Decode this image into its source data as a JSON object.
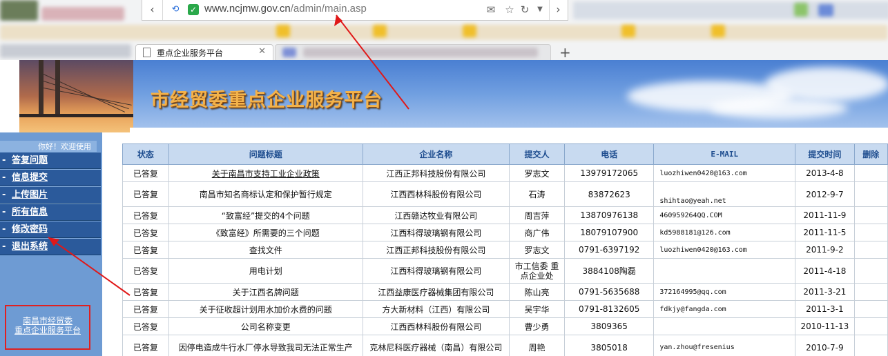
{
  "browser": {
    "url_host": "www.ncjmw.gov.cn",
    "url_path": "/admin/main.asp",
    "active_tab_title": "重点企业服务平台"
  },
  "banner": {
    "title": "市经贸委重点企业服务平台"
  },
  "sidebar": {
    "greeting": "你好！欢迎使用",
    "items": [
      {
        "label": "答复问题"
      },
      {
        "label": "信息提交"
      },
      {
        "label": "上传图片"
      },
      {
        "label": "所有信息"
      },
      {
        "label": "修改密码"
      },
      {
        "label": "退出系统"
      }
    ],
    "footer_line1": "南昌市经贸委",
    "footer_line2": "重点企业服务平台"
  },
  "table": {
    "headers": [
      "状态",
      "问题标题",
      "企业名称",
      "提交人",
      "电话",
      "E-MAIL",
      "提交时间",
      "删除"
    ],
    "rows": [
      {
        "status": "已答复",
        "title": "关于南昌市支持工业企业政策",
        "company": "江西正邦科技股份有限公司",
        "submitter": "罗志文",
        "phone": "13979172065",
        "email": "luozhiwen0420@163.com",
        "date": "2013-4-8"
      },
      {
        "status": "已答复",
        "title": "南昌市知名商标认定和保护暂行规定",
        "company": "江西西林科股份有限公司",
        "submitter": "石涛",
        "phone": "83872623",
        "email": "shihtao@yeah.net",
        "date": "2012-9-7"
      },
      {
        "status": "已答复",
        "title": "“致富经”提交的4个问题",
        "company": "江西赣达牧业有限公司",
        "submitter": "周吉萍",
        "phone": "13870976138",
        "email": "460959264QQ.COM",
        "date": "2011-11-9"
      },
      {
        "status": "已答复",
        "title": "《致富经》所需要的三个问题",
        "company": "江西科得玻璃钢有限公司",
        "submitter": "商广伟",
        "phone": "18079107900",
        "email": "kd5988181@126.com",
        "date": "2011-11-5"
      },
      {
        "status": "已答复",
        "title": "查找文件",
        "company": "江西正邦科技股份有限公司",
        "submitter": "罗志文",
        "phone": "0791-6397192",
        "email": "luozhiwen0420@163.com",
        "date": "2011-9-2"
      },
      {
        "status": "已答复",
        "title": "用电计划",
        "company": "江西科得玻璃钢有限公司",
        "submitter": "市工信委 重点企业处",
        "phone": "3884108陶磊",
        "email": "",
        "date": "2011-4-18"
      },
      {
        "status": "已答复",
        "title": "关于江西名牌问题",
        "company": "江西益康医疗器械集团有限公司",
        "submitter": "陈山亮",
        "phone": "0791-5635688",
        "email": "372164995@qq.com",
        "date": "2011-3-21"
      },
      {
        "status": "已答复",
        "title": "关于征收超计划用水加价水费的问题",
        "company": "方大新材料（江西）有限公司",
        "submitter": "吴宇华",
        "phone": "0791-8132605",
        "email": "fdkjy@fangda.com",
        "date": "2011-3-1"
      },
      {
        "status": "已答复",
        "title": "公司名称变更",
        "company": "江西西林科股份有限公司",
        "submitter": "曹少勇",
        "phone": "3809365",
        "email": "",
        "date": "2010-11-13"
      },
      {
        "status": "已答复",
        "title": "因停电造成牛行水厂停水导致我司无法正常生产",
        "company": "克林尼科医疗器械（南昌）有限公司",
        "submitter": "周艳",
        "phone": "3805018",
        "email": "yan.zhou@fresenius",
        "date": "2010-7-9"
      }
    ]
  }
}
